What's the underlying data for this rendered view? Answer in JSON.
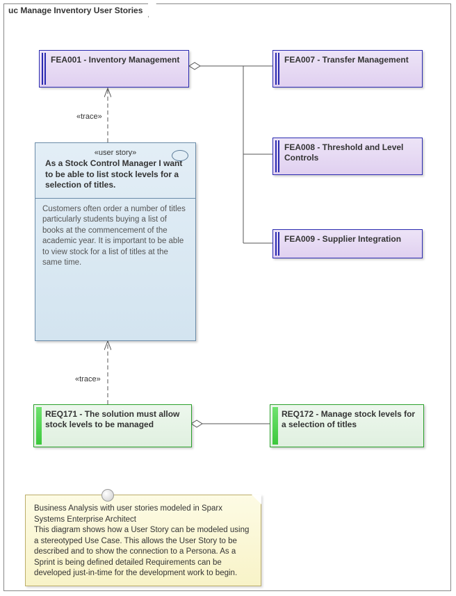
{
  "frame": {
    "title": "uc Manage Inventory User Stories"
  },
  "features": {
    "fea001": "FEA001 - Inventory Management",
    "fea007": "FEA007 - Transfer Management",
    "fea008": "FEA008 - Threshold and Level Controls",
    "fea009": "FEA009 - Supplier Integration"
  },
  "userstory": {
    "stereotype": "«user story»",
    "title": "As a Stock Control Manager I want to be able to list stock levels for a selection of titles.",
    "body": "Customers often order a number of titles particularly students buying a list of books at the commencement of the academic year. It is important to be able to view stock for a list of titles at the same time."
  },
  "requirements": {
    "req171": "REQ171 - The solution must allow stock levels to be managed",
    "req172": "REQ172 - Manage stock levels for a selection of titles"
  },
  "edges": {
    "trace1": "«trace»",
    "trace2": "«trace»"
  },
  "note": {
    "text": "Business Analysis with user stories modeled in Sparx Systems Enterprise Architect\nThis diagram shows how a User Story can be modeled using a stereotyped Use Case. This allows the User Story to be described and to show the connection to a Persona. As a Sprint is being defined detailed Requirements can be developed just-in-time for the development work to begin."
  }
}
